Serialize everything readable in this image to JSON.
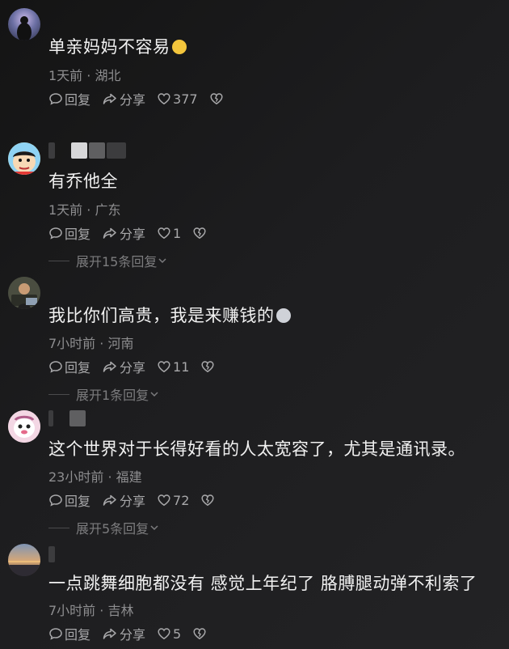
{
  "comments": [
    {
      "text": "单亲妈妈不容易",
      "time": "1天前",
      "location": "湖北",
      "reply": "回复",
      "share": "分享",
      "likes": "377"
    },
    {
      "text": "有乔他全",
      "time": "1天前",
      "location": "广东",
      "reply": "回复",
      "share": "分享",
      "likes": "1",
      "expand": "展开15条回复"
    },
    {
      "text": "我比你们高贵，我是来赚钱的",
      "time": "7小时前",
      "location": "河南",
      "reply": "回复",
      "share": "分享",
      "likes": "11",
      "expand": "展开1条回复"
    },
    {
      "text": "这个世界对于长得好看的人太宽容了，尤其是通讯录。",
      "time": "23小时前",
      "location": "福建",
      "reply": "回复",
      "share": "分享",
      "likes": "72",
      "expand": "展开5条回复"
    },
    {
      "text": "一点跳舞细胞都没有 感觉上年纪了 胳膊腿动弹不利索了",
      "time": "7小时前",
      "location": "吉林",
      "reply": "回复",
      "share": "分享",
      "likes": "5"
    }
  ],
  "separator": " · ",
  "icons": {
    "reply": "speech-bubble-icon",
    "share": "share-arrow-icon",
    "like": "heart-icon",
    "dislike": "broken-heart-icon",
    "expand": "chevron-down-icon"
  }
}
